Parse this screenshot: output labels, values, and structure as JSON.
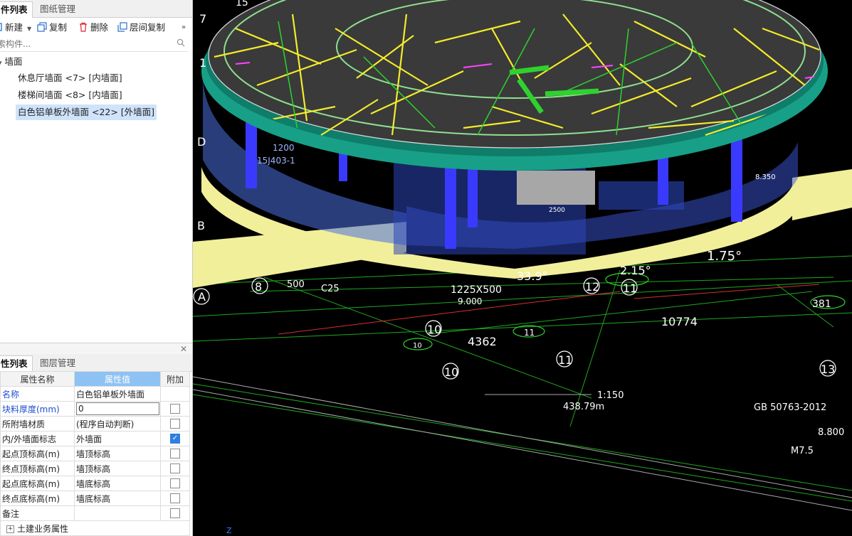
{
  "top_tabs": [
    "件列表",
    "图纸管理"
  ],
  "toolbar": {
    "new_label": "新建",
    "copy_label": "复制",
    "delete_label": "删除",
    "floor_copy_label": "层间复制",
    "more_icon": "double-chevron-right"
  },
  "search": {
    "placeholder": "索构件..."
  },
  "tree": {
    "root": "墙面",
    "items": [
      "休息厅墙面 <7> [内墙面]",
      "楼梯间墙面 <8> [内墙面]",
      "白色铝单板外墙面 <22> [外墙面]"
    ],
    "selected_index": 2
  },
  "bottom_tabs": [
    "性列表",
    "图层管理"
  ],
  "prop_headers": {
    "name": "属性名称",
    "value": "属性值",
    "extra": "附加"
  },
  "props": [
    {
      "name": "名称",
      "value": "白色铝单板外墙面",
      "checkbox": null,
      "highlight": true
    },
    {
      "name": "块料厚度(mm)",
      "value": "0",
      "checkbox": false,
      "highlight": true,
      "editing": true
    },
    {
      "name": "所附墙材质",
      "value": "(程序自动判断)",
      "checkbox": false
    },
    {
      "name": "内/外墙面标志",
      "value": "外墙面",
      "checkbox": true
    },
    {
      "name": "起点顶标高(m)",
      "value": "墙顶标高",
      "checkbox": false
    },
    {
      "name": "终点顶标高(m)",
      "value": "墙顶标高",
      "checkbox": false
    },
    {
      "name": "起点底标高(m)",
      "value": "墙底标高",
      "checkbox": false
    },
    {
      "name": "终点底标高(m)",
      "value": "墙底标高",
      "checkbox": false
    },
    {
      "name": "备注",
      "value": "",
      "checkbox": false
    }
  ],
  "prop_group": "土建业务属性",
  "viewport": {
    "annotations": {
      "dim_33_9": "33.9°",
      "dim_2_15": "2.15°",
      "dim_1_75": "1.75°",
      "dim_10774": "10774",
      "dim_4362": "4362",
      "dim_1225": "1225X500",
      "dim_9000": "9.000",
      "dim_1_150": "1:150",
      "dim_area": "438.79m",
      "dim_gb": "GB 50763-2012",
      "dim_8800": "8.800",
      "dim_m75": "M7.5",
      "dim_381": "381",
      "dim_2500": "2500",
      "dim_1200": "1200",
      "dim_15j": "15J403-1",
      "dim_8350": "8.350",
      "dim_c25": "C25",
      "dim_500": "500"
    },
    "axis_labels": {
      "a": "A",
      "b": "B",
      "d": "D",
      "seven": "7",
      "one": "1",
      "fifteen": "15",
      "z": "Z"
    },
    "bubbles": [
      "8",
      "12",
      "11",
      "10",
      "11",
      "10",
      "10",
      "11",
      "13"
    ],
    "colors": {
      "background": "#000000",
      "wall_yellow": "#f2ef9a",
      "glass_blue": "#3b55d8",
      "rim_teal": "#17a087",
      "line_yellow": "#f4ec2a",
      "line_green": "#2fd12f"
    }
  }
}
